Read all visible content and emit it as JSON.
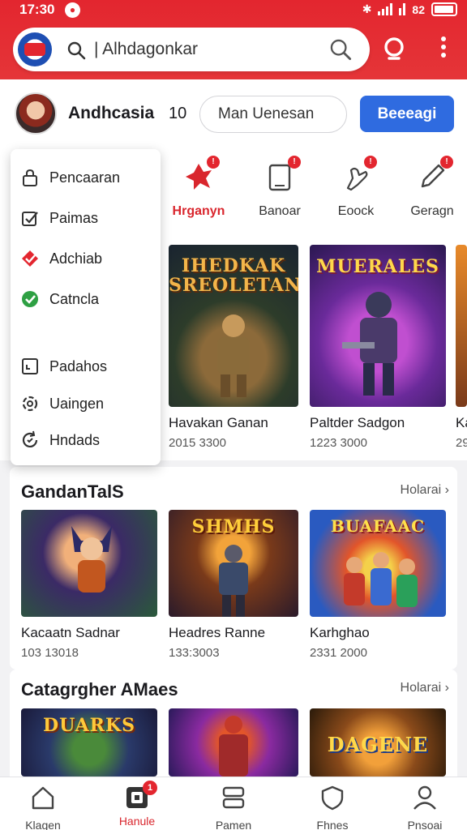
{
  "status_bar": {
    "time": "17:30",
    "left_icon": "notification-icon",
    "right_text": "82"
  },
  "search": {
    "query": "| Alhdagonkar",
    "app_logo": "app-logo-icon"
  },
  "profile": {
    "name": "Andhcasia",
    "count": "10",
    "input_value": "Man Uenesan",
    "button_label": "Beeeagi"
  },
  "categories": [
    {
      "label": "Hrganyn",
      "icon": "fire-icon",
      "active": true,
      "badge": "!"
    },
    {
      "label": "Banoar",
      "icon": "tablet-icon",
      "active": false,
      "badge": "!"
    },
    {
      "label": "Eoock",
      "icon": "hand-icon",
      "active": false,
      "badge": "!"
    },
    {
      "label": "Geragn",
      "icon": "pen-icon",
      "active": false,
      "badge": "!"
    }
  ],
  "menu": {
    "items": [
      {
        "label": "Pencaaran",
        "icon": "lock-icon"
      },
      {
        "label": "Paimas",
        "icon": "check-box-icon"
      },
      {
        "label": "Adchiab",
        "icon": "red-check-icon"
      },
      {
        "label": "Catncla",
        "icon": "green-check-icon"
      },
      {
        "label": "Padahos",
        "icon": "square-icon"
      },
      {
        "label": "Uaingen",
        "icon": "gear-icon"
      },
      {
        "label": "Hndads",
        "icon": "refresh-icon"
      }
    ]
  },
  "featured": [
    {
      "art_title": "IHEDKAK SREOLETAN",
      "title": "Havakan Ganan",
      "subtitle": "2015 3300"
    },
    {
      "art_title": "MUERALES",
      "title": "Paltder Sadgon",
      "subtitle": "1223 3000"
    },
    {
      "art_title": "",
      "title": "Ka",
      "subtitle": "29"
    }
  ],
  "section1": {
    "title": "GandanTalS",
    "link": "Holarai",
    "items": [
      {
        "art_title": "",
        "title": "Kacaatn Sadnar",
        "subtitle": "103 13018"
      },
      {
        "art_title": "SHMHS",
        "title": "Headres Ranne",
        "subtitle": "133:3003"
      },
      {
        "art_title": "BUAFAAC",
        "title": "Karhghao",
        "subtitle": "2331 2000"
      }
    ]
  },
  "section2": {
    "title": "Catagrgher AMaes",
    "link": "Holarai",
    "items": [
      {
        "art_title": "DUARKS",
        "title": "",
        "subtitle": ""
      },
      {
        "art_title": "",
        "title": "",
        "subtitle": ""
      },
      {
        "art_title": "DAGENE",
        "title": "",
        "subtitle": ""
      }
    ]
  },
  "bottom_nav": [
    {
      "label": "Klagen",
      "icon": "home-icon",
      "active": false
    },
    {
      "label": "Hanule",
      "icon": "library-icon",
      "active": true,
      "badge": "1"
    },
    {
      "label": "Pamen",
      "icon": "stack-icon",
      "active": false
    },
    {
      "label": "Fhnes",
      "icon": "shield-icon",
      "active": false
    },
    {
      "label": "Pnsoai",
      "icon": "person-icon",
      "active": false
    }
  ]
}
